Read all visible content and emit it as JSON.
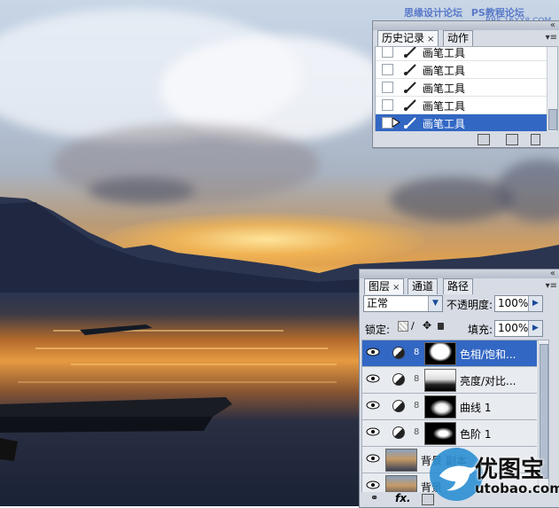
{
  "watermark": {
    "top_left_text": "思缘设计论坛",
    "top_right_text": "PS教程论坛",
    "sub_text": "BBS.16XX8.COM",
    "logo_cn": "优图宝",
    "logo_en": "utobao.com"
  },
  "history_panel": {
    "tabs": [
      {
        "label": "历史记录",
        "close": "×"
      },
      {
        "label": "动作"
      }
    ],
    "items": [
      {
        "label": "画笔工具",
        "selected": false
      },
      {
        "label": "画笔工具",
        "selected": false
      },
      {
        "label": "画笔工具",
        "selected": false
      },
      {
        "label": "画笔工具",
        "selected": false
      },
      {
        "label": "画笔工具",
        "selected": true
      }
    ]
  },
  "layers_panel": {
    "tabs": [
      {
        "label": "图层",
        "close": "×"
      },
      {
        "label": "通道"
      },
      {
        "label": "路径"
      }
    ],
    "blend_mode": "正常",
    "opacity_label": "不透明度:",
    "opacity_value": "100%",
    "lock_label": "锁定:",
    "fill_label": "填充:",
    "fill_value": "100%",
    "layers": [
      {
        "name": "色相/饱和...",
        "type": "adjustment",
        "selected": true
      },
      {
        "name": "亮度/对比...",
        "type": "adjustment",
        "selected": false
      },
      {
        "name": "曲线 1",
        "type": "adjustment",
        "selected": false
      },
      {
        "name": "色阶 1",
        "type": "adjustment",
        "selected": false
      },
      {
        "name": "背景 副本",
        "type": "image",
        "selected": false
      },
      {
        "name": "背景",
        "type": "image",
        "selected": false
      }
    ],
    "footer_fx": "fx."
  },
  "colors": {
    "selection": "#3267c3",
    "panel_bg": "#d6dbe4",
    "watermark_blue": "#5a7ac9"
  }
}
